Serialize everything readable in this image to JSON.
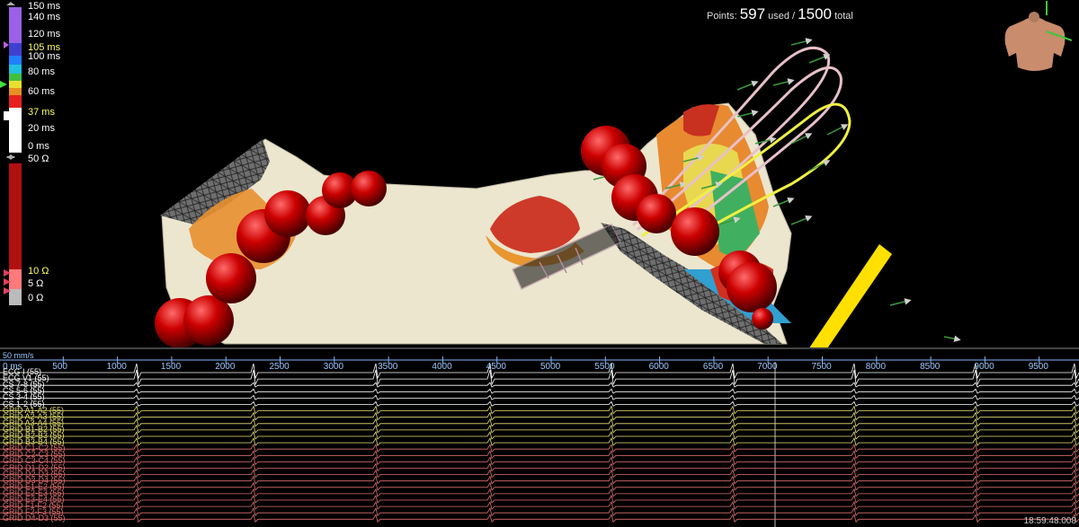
{
  "points": {
    "label": "Points:",
    "used": "597",
    "used_label": "used /",
    "total": "1500",
    "total_label": "total"
  },
  "lat_scale": {
    "labels": [
      "150 ms",
      "140 ms",
      "120 ms",
      "105 ms",
      "100 ms",
      "80 ms",
      "60 ms",
      "37 ms",
      "20 ms",
      "0 ms"
    ],
    "highlight": [
      "105 ms",
      "37 ms"
    ]
  },
  "imp_scale": {
    "labels": [
      "50 Ω",
      "10 Ω",
      "5 Ω",
      "0 Ω"
    ],
    "highlight": [
      "10 Ω"
    ]
  },
  "timeline": {
    "units": "50 mm/s",
    "zero": "0 ms",
    "ticks": [
      "500",
      "1000",
      "1500",
      "2000",
      "2500",
      "3000",
      "3500",
      "4000",
      "4500",
      "5000",
      "5500",
      "6000",
      "6500",
      "7000",
      "7500",
      "8000",
      "8500",
      "9000",
      "9500"
    ]
  },
  "channels": [
    {
      "name": "ECG I (55)",
      "color": "#ffffff"
    },
    {
      "name": "ECG V1 (55)",
      "color": "#ffffff"
    },
    {
      "name": "CS 7-8 (55)",
      "color": "#ffffff"
    },
    {
      "name": "CS 5-6 (55)",
      "color": "#ffffff"
    },
    {
      "name": "CS 3-4 (55)",
      "color": "#ffffff"
    },
    {
      "name": "CS 1-2 (55)",
      "color": "#ffffff"
    },
    {
      "name": "GRID A1-A2 (55)",
      "color": "#e8e070"
    },
    {
      "name": "GRID A2-A3 (55)",
      "color": "#e8e070"
    },
    {
      "name": "GRID A3-A4 (55)",
      "color": "#e8e070"
    },
    {
      "name": "GRID B1-B2 (55)",
      "color": "#e8e070"
    },
    {
      "name": "GRID B2-B3 (55)",
      "color": "#e8e070"
    },
    {
      "name": "GRID B3-B4 (55)",
      "color": "#e8e070"
    },
    {
      "name": "GRID C1-C2 (55)",
      "color": "#e07070"
    },
    {
      "name": "GRID C2-C3 (55)",
      "color": "#e07070"
    },
    {
      "name": "GRID C3-C4 (55)",
      "color": "#e07070"
    },
    {
      "name": "GRID D1-D2 (55)",
      "color": "#e07070"
    },
    {
      "name": "GRID D2-D3 (55)",
      "color": "#e07070"
    },
    {
      "name": "GRID D3-D4 (55)",
      "color": "#e07070"
    },
    {
      "name": "GRID E1-E2 (55)",
      "color": "#e07070"
    },
    {
      "name": "GRID E2-E3 (55)",
      "color": "#e07070"
    },
    {
      "name": "GRID E3-E4 (55)",
      "color": "#e07070"
    },
    {
      "name": "GRID F1-F2 (55)",
      "color": "#e07070"
    },
    {
      "name": "GRID F2-F3 (55)",
      "color": "#e07070"
    },
    {
      "name": "GRID D4-D3 (55)",
      "color": "#e07070"
    }
  ],
  "clock": "18:59:48.008",
  "colors": {
    "tissue": "#ece6cf",
    "lesion": "#c80000",
    "arrow": "#ffe000",
    "timeline": "#7fb8ff"
  }
}
